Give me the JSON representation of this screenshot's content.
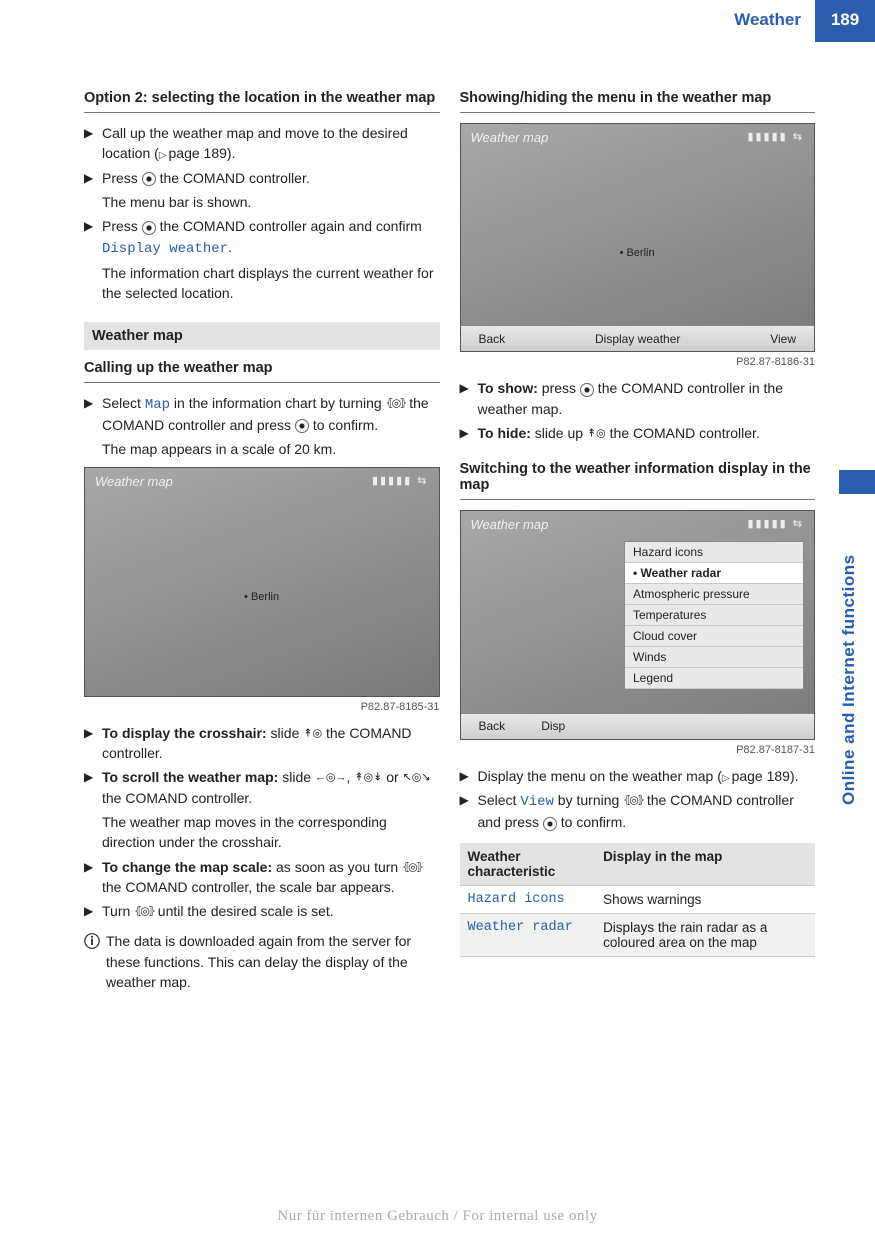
{
  "header": {
    "title": "Weather",
    "page": "189"
  },
  "side": {
    "label": "Online and Internet functions"
  },
  "left": {
    "h1": "Option 2: selecting the location in the weather map",
    "s1a": "Call up the weather map and move to the desired location (",
    "s1b": "page 189).",
    "s2a": "Press ",
    "s2b": " the COMAND controller.",
    "s2c": "The menu bar is shown.",
    "s3a": "Press ",
    "s3b": " the COMAND controller again and confirm ",
    "s3ocr": "Display weather",
    "s3c": ".",
    "s3d": "The information chart displays the current weather for the selected location.",
    "sec": "Weather map",
    "h2": "Calling up the weather map",
    "c1a": "Select ",
    "c1ocr": "Map",
    "c1b": " in the information chart by turning ",
    "c1c": " the COMAND controller and press ",
    "c1d": " to confirm.",
    "c1e": "The map appears in a scale of 20 km.",
    "scr1": {
      "title": "Weather map",
      "bars": "▮▮▮▮▮  ⇆",
      "point": "• Berlin",
      "code": "P82.87-8185-31"
    },
    "d1a": "To display the crosshair:",
    "d1b": " slide ",
    "d1c": " the COMAND controller.",
    "d2a": "To scroll the weather map:",
    "d2b": " slide ",
    "d2c": ", ",
    "d2d": " or ",
    "d2e": " the COMAND controller.",
    "d2f": "The weather map moves in the corresponding direction under the crosshair.",
    "d3a": "To change the map scale:",
    "d3b": " as soon as you turn ",
    "d3c": " the COMAND controller, the scale bar appears.",
    "d4a": "Turn ",
    "d4b": " until the desired scale is set.",
    "info": "The data is downloaded again from the server for these functions. This can delay the display of the weather map."
  },
  "right": {
    "h1": "Showing/hiding the menu in the weather map",
    "scr2": {
      "title": "Weather map",
      "bars": "▮▮▮▮▮  ⇆",
      "point": "• Berlin",
      "back": "Back",
      "mid": "Display weather",
      "view": "View",
      "code": "P82.87-8186-31"
    },
    "s1a": "To show:",
    "s1b": " press ",
    "s1c": " the COMAND controller in the weather map.",
    "s2a": "To hide:",
    "s2b": " slide up ",
    "s2c": " the COMAND controller.",
    "h2": "Switching to the weather information display in the map",
    "scr3": {
      "title": "Weather map",
      "bars": "▮▮▮▮▮  ⇆",
      "menu": [
        "Hazard icons",
        "Weather radar",
        "Atmospheric pressure",
        "Temperatures",
        "Cloud cover",
        "Winds",
        "Legend"
      ],
      "selIndex": 1,
      "back": "Back",
      "disp": "Disp",
      "code": "P82.87-8187-31"
    },
    "t1a": "Display the menu on the weather map (",
    "t1b": "page 189).",
    "t2a": "Select ",
    "t2ocr": "View",
    "t2b": " by turning ",
    "t2c": " the COMAND controller and press ",
    "t2d": " to confirm.",
    "table": {
      "h1": "Weather characteristic",
      "h2": "Display in the map",
      "r1a": "Hazard icons",
      "r1b": "Shows warnings",
      "r2a": "Weather radar",
      "r2b": "Displays the rain radar as a coloured area on the map"
    }
  },
  "footer": "Nur für internen Gebrauch / For internal use only"
}
